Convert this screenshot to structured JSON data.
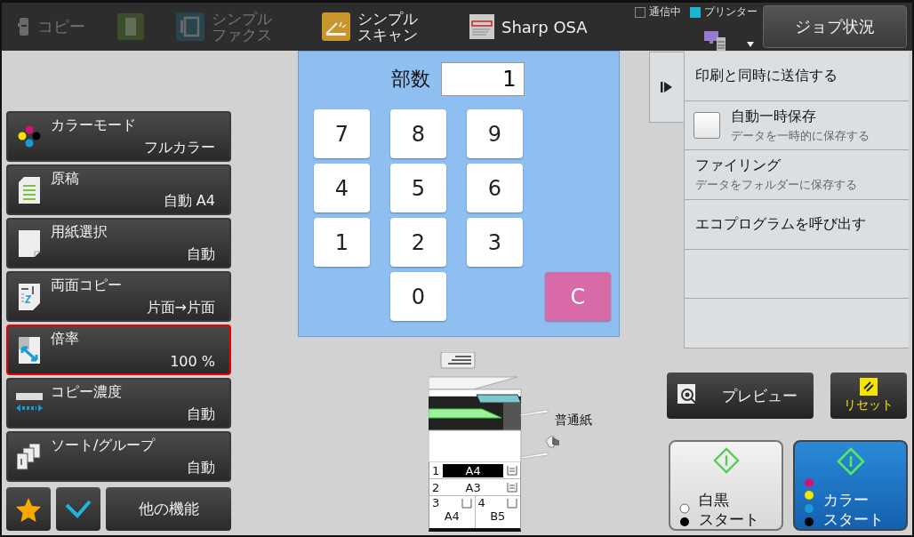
{
  "top_bar": {
    "tabs": [
      {
        "kind": "copy",
        "lines": [
          "コピー"
        ],
        "dimmed": true
      },
      {
        "kind": "copy-green",
        "dimmed": true
      },
      {
        "kind": "fax",
        "lines": [
          "シンプル",
          "ファクス"
        ],
        "dimmed": true
      },
      {
        "kind": "scan",
        "lines": [
          "シンプル",
          "スキャン"
        ],
        "dimmed": false
      },
      {
        "kind": "osa",
        "lines": [
          "Sharp OSA"
        ],
        "dimmed": false
      }
    ],
    "indicators": [
      {
        "label": "通信中",
        "checked": false
      },
      {
        "label": "プリンター",
        "checked": true
      }
    ],
    "job_status_button": "ジョブ状況"
  },
  "settings": [
    {
      "kind": "color",
      "title": "カラーモード",
      "value": "フルカラー",
      "highlighted": false
    },
    {
      "kind": "original",
      "title": "原稿",
      "value": "自動 A4",
      "highlighted": false
    },
    {
      "kind": "paper",
      "title": "用紙選択",
      "value": "自動",
      "highlighted": false
    },
    {
      "kind": "duplex",
      "title": "両面コピー",
      "value": "片面→片面",
      "highlighted": false
    },
    {
      "kind": "ratio",
      "title": "倍率",
      "value": "100 %",
      "highlighted": true
    },
    {
      "kind": "density",
      "title": "コピー濃度",
      "value": "自動",
      "highlighted": false
    },
    {
      "kind": "sort",
      "title": "ソート/グループ",
      "value": "自動",
      "highlighted": false
    }
  ],
  "bottom_left": {
    "other_functions": "他の機能"
  },
  "keypad": {
    "copies_label": "部数",
    "copies_value": "1",
    "keys": [
      {
        "kind": "digit",
        "label": "7"
      },
      {
        "kind": "digit",
        "label": "8"
      },
      {
        "kind": "digit",
        "label": "9"
      },
      {
        "kind": "digit",
        "label": "4"
      },
      {
        "kind": "digit",
        "label": "5"
      },
      {
        "kind": "digit",
        "label": "6"
      },
      {
        "kind": "digit",
        "label": "1"
      },
      {
        "kind": "digit",
        "label": "2"
      },
      {
        "kind": "digit",
        "label": "3"
      },
      {
        "kind": "digit",
        "label": "0"
      },
      {
        "kind": "clear",
        "label": "C"
      }
    ]
  },
  "machine": {
    "paper_type": "普通紙",
    "trays": [
      {
        "kind": "full",
        "number": "1",
        "size": "A4",
        "selected": true
      },
      {
        "kind": "full",
        "number": "2",
        "size": "A3",
        "selected": false
      },
      {
        "kind": "half",
        "number": "3",
        "size": "A4",
        "selected": false
      },
      {
        "kind": "half",
        "number": "4",
        "size": "B5",
        "selected": false
      }
    ]
  },
  "action_menu": [
    {
      "kind": "text",
      "label": "印刷と同時に送信する"
    },
    {
      "kind": "checkbox",
      "label": "自動一時保存",
      "sub": "データを一時的に保存する",
      "checked": false
    },
    {
      "kind": "sub",
      "label": "ファイリング",
      "sub": "データをフォルダーに保存する"
    },
    {
      "kind": "text",
      "label": "エコプログラムを呼び出す"
    },
    {
      "kind": "empty"
    },
    {
      "kind": "empty"
    }
  ],
  "buttons": {
    "preview": "プレビュー",
    "reset": "リセット",
    "mono_start": [
      "白黒",
      "スタート"
    ],
    "color_start": [
      "カラー",
      "スタート"
    ]
  }
}
